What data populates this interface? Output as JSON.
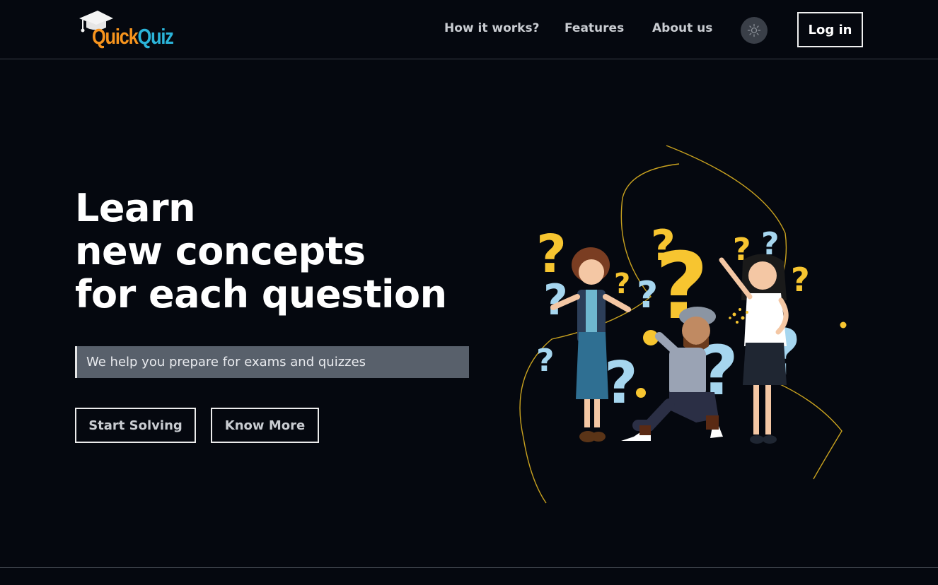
{
  "navbar": {
    "logo_part1": "Quick",
    "logo_part2": "Quiz",
    "links": [
      "How it works?",
      "Features",
      "About us"
    ],
    "theme_toggle_icon": "sun-icon",
    "login_label": "Log in"
  },
  "hero": {
    "title_lines": [
      "Learn",
      "new concepts",
      "for each question"
    ],
    "subtitle": "We help you prepare for exams and quizzes",
    "start_label": "Start Solving",
    "more_label": "Know More",
    "illustration_icon": "people-with-question-marks-illustration"
  },
  "colors": {
    "background": "#05080f",
    "accent_yellow": "#f7c530",
    "accent_blue": "#a6d6ef",
    "logo_orange": "#f7941d",
    "logo_blue": "#2bb4d9"
  }
}
